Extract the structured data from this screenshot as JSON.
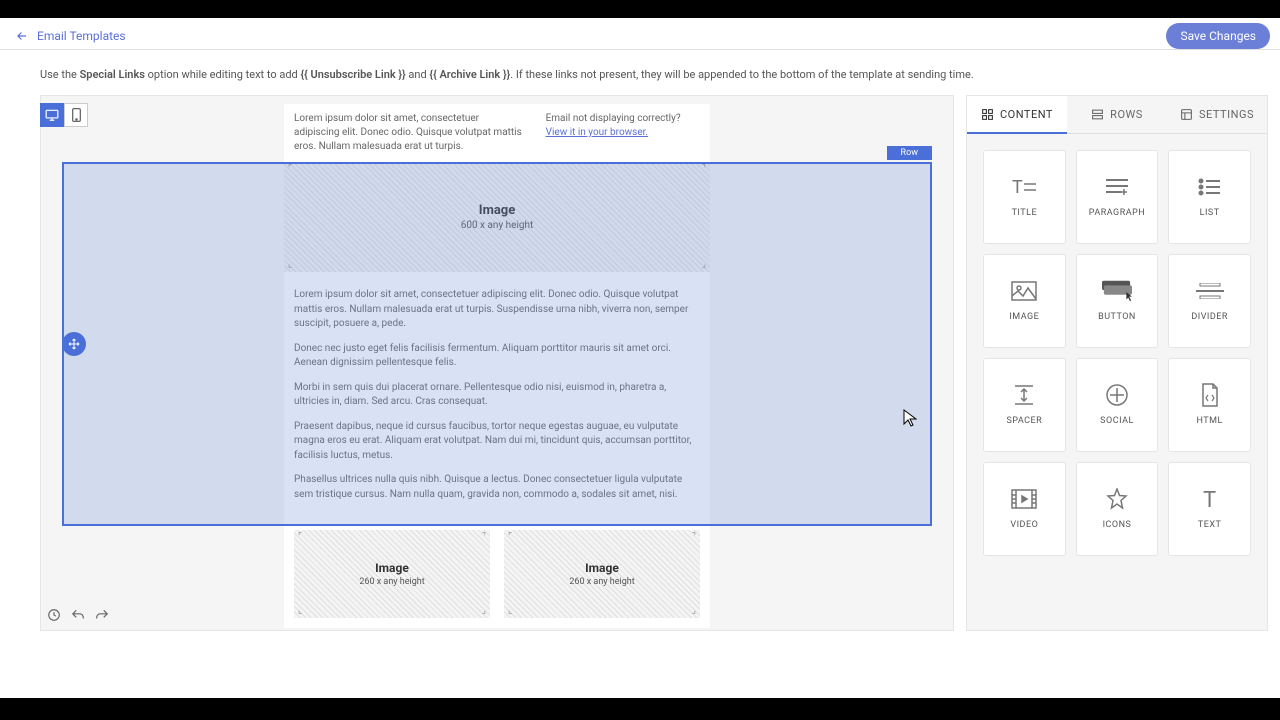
{
  "header": {
    "back_label": "Email Templates",
    "save_label": "Save Changes"
  },
  "hint": {
    "prefix": "Use the ",
    "special_links": "Special Links",
    "mid1": " option while editing text to add ",
    "unsub": "{{ Unsubscribe Link }}",
    "and": " and ",
    "archive": "{{ Archive Link }}",
    "suffix": ". If these links not present, they will be appended to the bottom of the template at sending time."
  },
  "email": {
    "preheader_left": "Lorem ipsum dolor sit amet, consectetuer adipiscing elit. Donec odio. Quisque volutpat mattis eros. Nullam malesuada erat ut turpis.",
    "preheader_right_label": "Email not displaying correctly?",
    "preheader_right_link": "View it in your browser.",
    "image_big_title": "Image",
    "image_big_sub": "600 x any height",
    "p1": "Lorem ipsum dolor sit amet, consectetuer adipiscing elit. Donec odio. Quisque volutpat mattis eros. Nullam malesuada erat ut turpis. Suspendisse urna nibh, viverra non, semper suscipit, posuere a, pede.",
    "p2": "Donec nec justo eget felis facilisis fermentum. Aliquam porttitor mauris sit amet orci. Aenean dignissim pellentesque felis.",
    "p3": "Morbi in sem quis dui placerat ornare. Pellentesque odio nisi, euismod in, pharetra a, ultricies in, diam. Sed arcu. Cras consequat.",
    "p4": "Praesent dapibus, neque id cursus faucibus, tortor neque egestas auguae, eu vulputate magna eros eu erat. Aliquam erat volutpat. Nam dui mi, tincidunt quis, accumsan porttitor, facilisis luctus, metus.",
    "p5": "Phasellus ultrices nulla quis nibh. Quisque a lectus. Donec consectetuer ligula vulputate sem tristique cursus. Nam nulla quam, gravida non, commodo a, sodales sit amet, nisi.",
    "image_small_title": "Image",
    "image_small_sub": "260 x any height",
    "row_badge": "Row"
  },
  "tabs": {
    "content": "CONTENT",
    "rows": "ROWS",
    "settings": "SETTINGS"
  },
  "widgets": {
    "title": "TITLE",
    "paragraph": "PARAGRAPH",
    "list": "LIST",
    "image": "IMAGE",
    "button": "BUTTON",
    "divider": "DIVIDER",
    "spacer": "SPACER",
    "social": "SOCIAL",
    "html": "HTML",
    "video": "VIDEO",
    "icons": "ICONS",
    "text": "TEXT"
  }
}
